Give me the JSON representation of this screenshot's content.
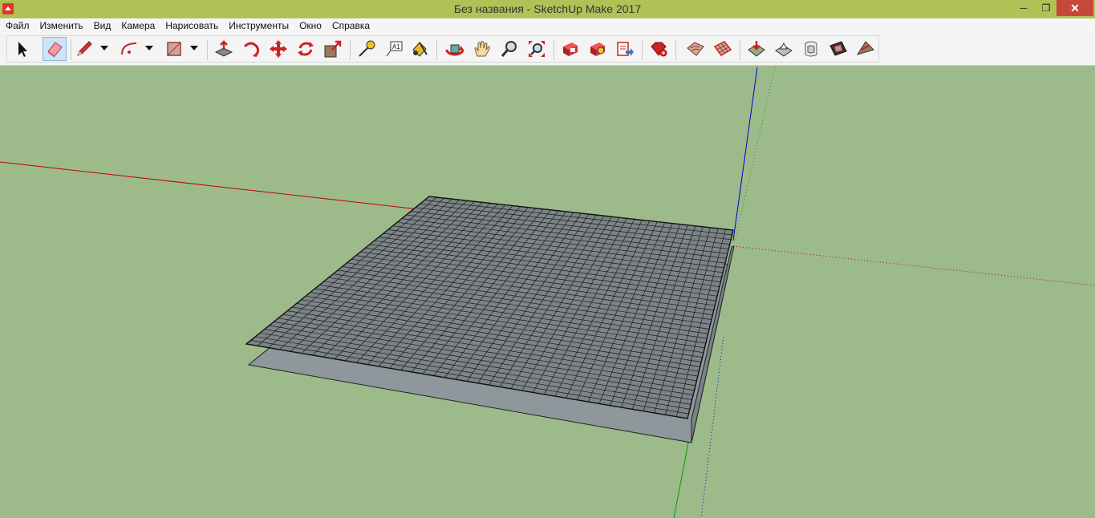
{
  "window": {
    "title": "Без названия - SketchUp Make 2017",
    "minimize_glyph": "─",
    "maximize_glyph": "❐",
    "close_glyph": "✕",
    "titlebar_color": "#b2c155"
  },
  "menu": [
    "Файл",
    "Изменить",
    "Вид",
    "Камера",
    "Нарисовать",
    "Инструменты",
    "Окно",
    "Справка"
  ],
  "toolbar": {
    "tools": [
      "select",
      "eraser",
      "pencil-line",
      "arc",
      "rectangle",
      "push-pull",
      "follow-me",
      "move",
      "rotate",
      "scale",
      "tape-measure",
      "text",
      "paint-bucket",
      "orbit",
      "pan",
      "zoom",
      "zoom-extents",
      "3d-warehouse",
      "extension-warehouse",
      "send-to-layout",
      "extension-manager",
      "sandbox-from-contours",
      "sandbox-from-scratch",
      "smoove",
      "stamp",
      "drape",
      "add-detail",
      "flip-edge"
    ],
    "active_tool": "eraser"
  },
  "viewport": {
    "background_color": "#9dbb8a",
    "axis_colors": {
      "red": "#c00000",
      "green": "#00a000",
      "blue": "#0000d0"
    },
    "grid_face_color": "#7c8488",
    "base_face_color": "#8e979b"
  }
}
